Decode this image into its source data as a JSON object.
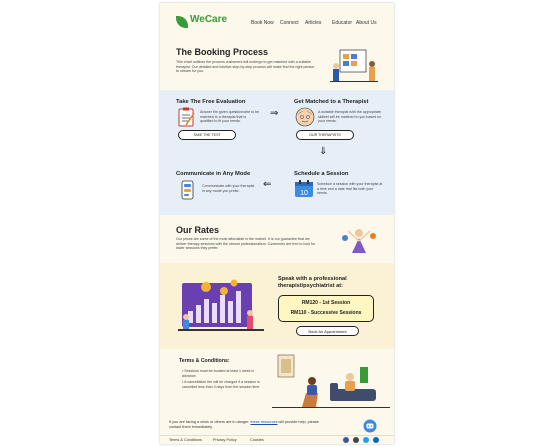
{
  "brand": {
    "name": "WeCare",
    "color": "#3a9a3a"
  },
  "nav": {
    "items": [
      "Book Now",
      "Connect",
      "Articles",
      "Educator",
      "About Us"
    ]
  },
  "intro": {
    "title": "The Booking Process",
    "text": "This chart outlines the process customers will undergo to get matched with a suitable therapist. Our detailed and intuitive step-by-step process will make find the right person to stream for you."
  },
  "steps": [
    {
      "title": "Take The Free Evaluation",
      "text": "Answer the given questionnaire to be matched to a therapist that is qualified to fit your needs.",
      "button": "TAKE THE TEST"
    },
    {
      "title": "Get Matched to a Therapist",
      "text": "A suitable therapist with the appropriate skillset will be matched to you based on your needs.",
      "button": "OUR THERAPISTS"
    },
    {
      "title": "Schedule a Session",
      "text": "Schedule a session with your therapist at a time and a date that fits both your needs.",
      "calendar_day": "10"
    },
    {
      "title": "Communicate in Any Mode",
      "text": "Communicate with your therapist in any mode you prefer."
    }
  ],
  "rates": {
    "title": "Our Rates",
    "text": "Our prices are some of the most affordable in the market. It is our guarantee that we deliver therapy sessions with the utmost professionalism. Customers are free to look for lower sessions they prefer."
  },
  "promo": {
    "heading": "Speak with a professional therapist/psychiatrist at:",
    "price1": "RM120 - 1st Session",
    "price2": "RM110 - Successive Sessions",
    "button": "Book An Appointment"
  },
  "terms": {
    "title": "Terms & Conditions:",
    "items": [
      "Sessions must be booked at least 1 week in advance.",
      "A cancellation fee will be charged if a session is cancelled less than 3 days from the session time."
    ]
  },
  "help": {
    "prefix": "If you are facing a crisis or others are in danger: ",
    "link": "these resources",
    "suffix": " will provide help, please contact them immediately."
  },
  "footer": {
    "links": [
      "Terms & Conditions",
      "Privacy Policy",
      "Cookies"
    ]
  },
  "icons": [
    "facebook-icon",
    "instagram-icon",
    "twitter-icon",
    "linkedin-icon",
    "chat-bot-icon"
  ]
}
